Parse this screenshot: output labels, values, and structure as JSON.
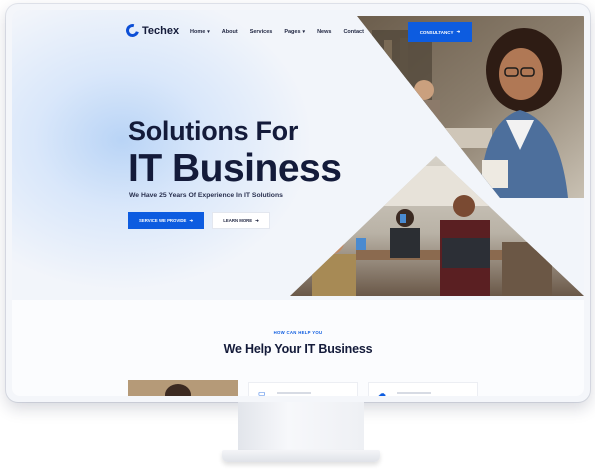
{
  "brand": {
    "name": "Techex",
    "accent": "#0d5ce0",
    "dark": "#141b3a"
  },
  "nav": {
    "items": [
      {
        "label": "Home",
        "has_dropdown": true
      },
      {
        "label": "About",
        "has_dropdown": false
      },
      {
        "label": "Services",
        "has_dropdown": false
      },
      {
        "label": "Pages",
        "has_dropdown": true
      },
      {
        "label": "News",
        "has_dropdown": false
      },
      {
        "label": "Contact",
        "has_dropdown": false
      }
    ],
    "cta_label": "CONSULTANCY",
    "cta_icon": "arrow-right-icon"
  },
  "hero": {
    "title_line1": "Solutions For",
    "title_line2": "IT Business",
    "subtitle": "We Have 25 Years Of Experience In IT Solutions",
    "primary_button": "SERVICE WE PROVIDE",
    "secondary_button": "LEARN MORE"
  },
  "section": {
    "label": "HOW CAN HELP YOU",
    "title": "We Help Your IT Business"
  },
  "cards": [
    {
      "icon": "photo"
    },
    {
      "icon": "monitor-icon"
    },
    {
      "icon": "cloud-icon"
    }
  ]
}
